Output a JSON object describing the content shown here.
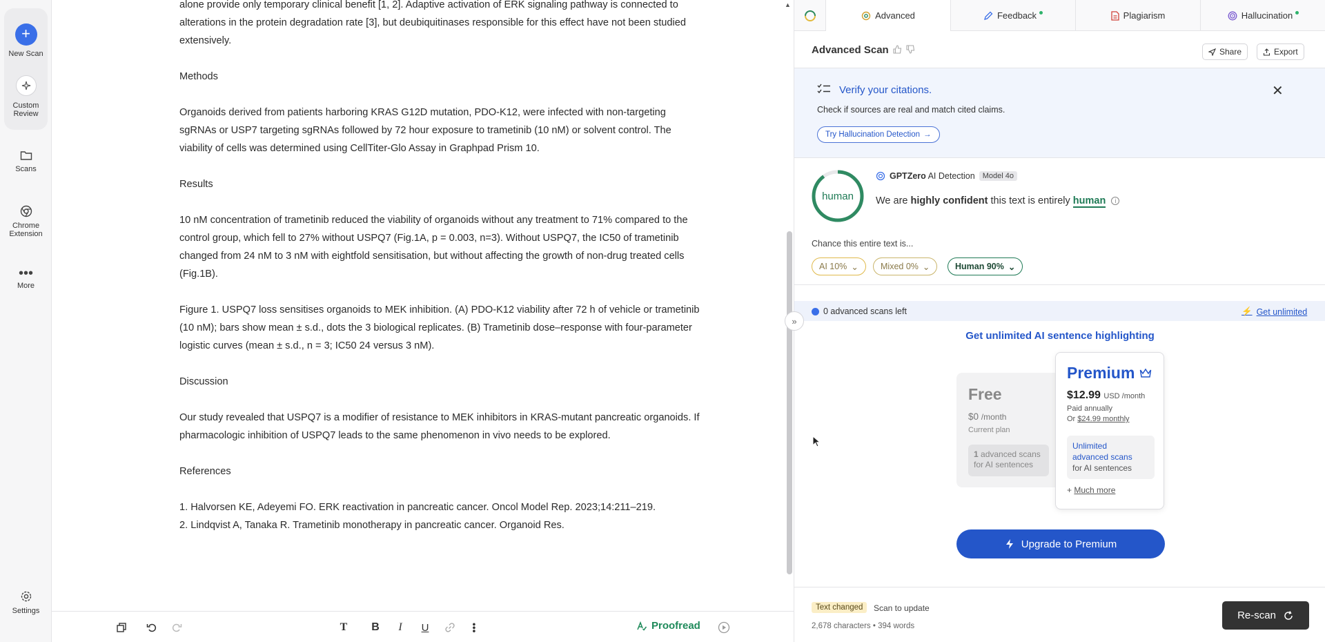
{
  "rail": {
    "new_scan": "New Scan",
    "custom_review_line1": "Custom",
    "custom_review_line2": "Review",
    "scans": "Scans",
    "chrome_line1": "Chrome",
    "chrome_line2": "Extension",
    "more": "More",
    "settings": "Settings"
  },
  "doc": {
    "intro": "alone provide only temporary clinical benefit [1, 2]. Adaptive activation of ERK signaling pathway is connected to alterations in the protein degradation rate [3], but deubiquitinases responsible for this effect have not been studied extensively.",
    "methods_heading": "Methods",
    "methods": "Organoids derived from patients harboring KRAS G12D mutation, PDO-K12, were infected with non-targeting sgRNAs or USP7 targeting sgRNAs followed by 72 hour exposure to trametinib (10 nM) or solvent control. The viability of cells was determined using CellTiter-Glo Assay in Graphpad Prism 10.",
    "results_heading": "Results",
    "results": "10 nM concentration of trametinib reduced the viability of organoids without any treatment to 71% compared to the control group, which fell to 27% without USPQ7 (Fig.1A, p = 0.003, n=3). Without USPQ7, the IC50 of trametinib changed from 24 nM to 3 nM with eightfold sensitisation, but without affecting the growth of non-drug treated cells (Fig.1B).",
    "figure_caption": "Figure 1. USPQ7 loss sensitises organoids to MEK inhibition. (A) PDO-K12 viability after 72 h of vehicle or trametinib (10 nM); bars show mean ± s.d., dots the 3 biological replicates. (B) Trametinib dose–response with four-parameter logistic curves (mean ± s.d., n = 3; IC50 24 versus 3 nM).",
    "discussion_heading": "Discussion",
    "discussion": "Our study revealed that USPQ7 is a modifier of resistance to MEK inhibitors in KRAS-mutant pancreatic organoids. If pharmacologic inhibition of USPQ7 leads to the same phenomenon in vivo needs to be explored.",
    "references_heading": "References",
    "references": [
      "1. Halvorsen KE, Adeyemi FO. ERK reactivation in pancreatic cancer. Oncol Model Rep. 2023;14:211–219.",
      "2. Lindqvist A, Tanaka R. Trametinib monotherapy in pancreatic cancer. Organoid Res."
    ]
  },
  "toolbar": {
    "proofread": "Proofread"
  },
  "panel": {
    "tabs": [
      {
        "label": "Advanced"
      },
      {
        "label": "Feedback"
      },
      {
        "label": "Plagiarism"
      },
      {
        "label": "Hallucination"
      }
    ],
    "header_title": "Advanced Scan",
    "share": "Share",
    "export": "Export",
    "banner": {
      "title": "Verify your citations.",
      "desc": "Check if sources are real and match cited claims.",
      "button": "Try Hallucination Detection"
    },
    "result": {
      "ring_label": "human",
      "brand": "GPTZero",
      "product": "AI Detection",
      "model": "Model 4o",
      "conf_pre": "We are",
      "conf_strong": "highly confident",
      "conf_mid": "this text is entirely",
      "conf_human": "human",
      "chance": "Chance this entire text is...",
      "ai_pill": "AI 10%",
      "mixed_pill": "Mixed 0%",
      "human_pill": "Human 90%",
      "human_fraction": 0.9
    },
    "scans_left": "0 advanced scans left",
    "get_unlimited": "Get unlimited",
    "unlimited_title": "Get unlimited AI sentence highlighting",
    "free": {
      "title": "Free",
      "price": "$0",
      "unit": "/month",
      "plan": "Current plan",
      "feat_strong": "1",
      "feat_rest": "advanced scans",
      "feat_line2": "for AI sentences"
    },
    "premium": {
      "title": "Premium",
      "price": "$12.99",
      "unit": "USD /month",
      "annual": "Paid annually",
      "or": "Or",
      "monthly": "$24.99 monthly",
      "feat_line1": "Unlimited",
      "feat_line2": "advanced scans",
      "feat_line3": "for AI sentences",
      "more_prefix": "+",
      "more": "Much more"
    },
    "upgrade": "Upgrade to Premium",
    "footer": {
      "changed": "Text changed",
      "scan_update": "Scan to update",
      "counts": "2,678 characters • 394 words",
      "rescan": "Re-scan"
    }
  }
}
